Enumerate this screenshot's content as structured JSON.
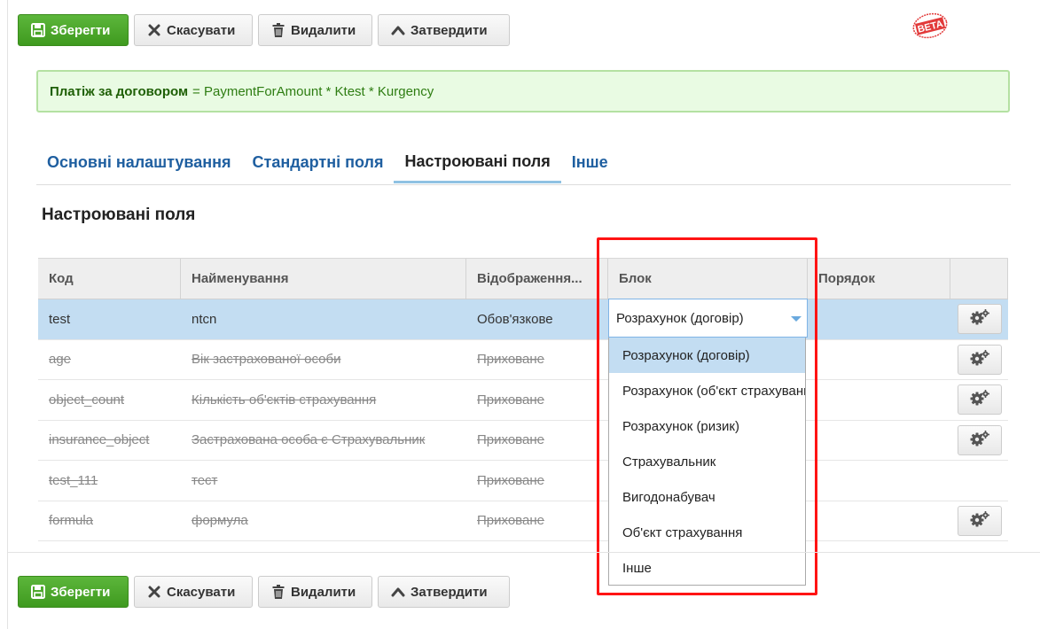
{
  "toolbar": {
    "save": "Зберегти",
    "cancel": "Скасувати",
    "delete": "Видалити",
    "approve": "Затвердити"
  },
  "badge": {
    "text": "BETA"
  },
  "formula": {
    "label": "Платіж за договором",
    "expression": "= PaymentForAmount * Ktest * Kurgency"
  },
  "tabs": [
    "Основні налаштування",
    "Стандартні поля",
    "Настроювані поля",
    "Інше"
  ],
  "active_tab": "Настроювані поля",
  "section_title": "Настроювані поля",
  "table": {
    "headers": [
      "Код",
      "Найменування",
      "Відображення...",
      "Блок",
      "Порядок",
      ""
    ],
    "rows": [
      {
        "code": "test",
        "name": "ntcn",
        "display": "Обов'язкове",
        "block": "Розрахунок (договір)",
        "order": "",
        "state": "selected"
      },
      {
        "code": "age",
        "name": "Вік застрахованої особи",
        "display": "Приховане",
        "block": "",
        "order": "",
        "state": "hidden"
      },
      {
        "code": "object_count",
        "name": "Кількість об'єктів страхування",
        "display": "Приховане",
        "block": "",
        "order": "",
        "state": "hidden"
      },
      {
        "code": "insurance_object",
        "name": "Застрахована особа є Страхувальник",
        "display": "Приховане",
        "block": "",
        "order": "",
        "state": "hidden"
      },
      {
        "code": "test_111",
        "name": "тест",
        "display": "Приховане",
        "block": "",
        "order": "",
        "state": "hidden"
      },
      {
        "code": "formula",
        "name": "формула",
        "display": "Приховане",
        "block": "",
        "order": "",
        "state": "hidden"
      }
    ]
  },
  "block_select": {
    "value": "Розрахунок (договір)",
    "options": [
      "Розрахунок (договір)",
      "Розрахунок (об'єкт страхування)",
      "Розрахунок (ризик)",
      "Страхувальник",
      "Вигодонабувач",
      "Об'єкт страхування",
      "Інше"
    ],
    "highlighted_index": 0
  },
  "colors": {
    "primary_green": "#4cae2c",
    "link_blue": "#1f5fa0",
    "selection": "#c3ddf2",
    "highlight_box": "#ff1414",
    "formula_bg": "#e9fbe3"
  },
  "icons": [
    "save-icon",
    "close-icon",
    "trash-icon",
    "chevron-up-icon",
    "gear-icon",
    "beta-badge-icon",
    "caret-down-icon"
  ]
}
